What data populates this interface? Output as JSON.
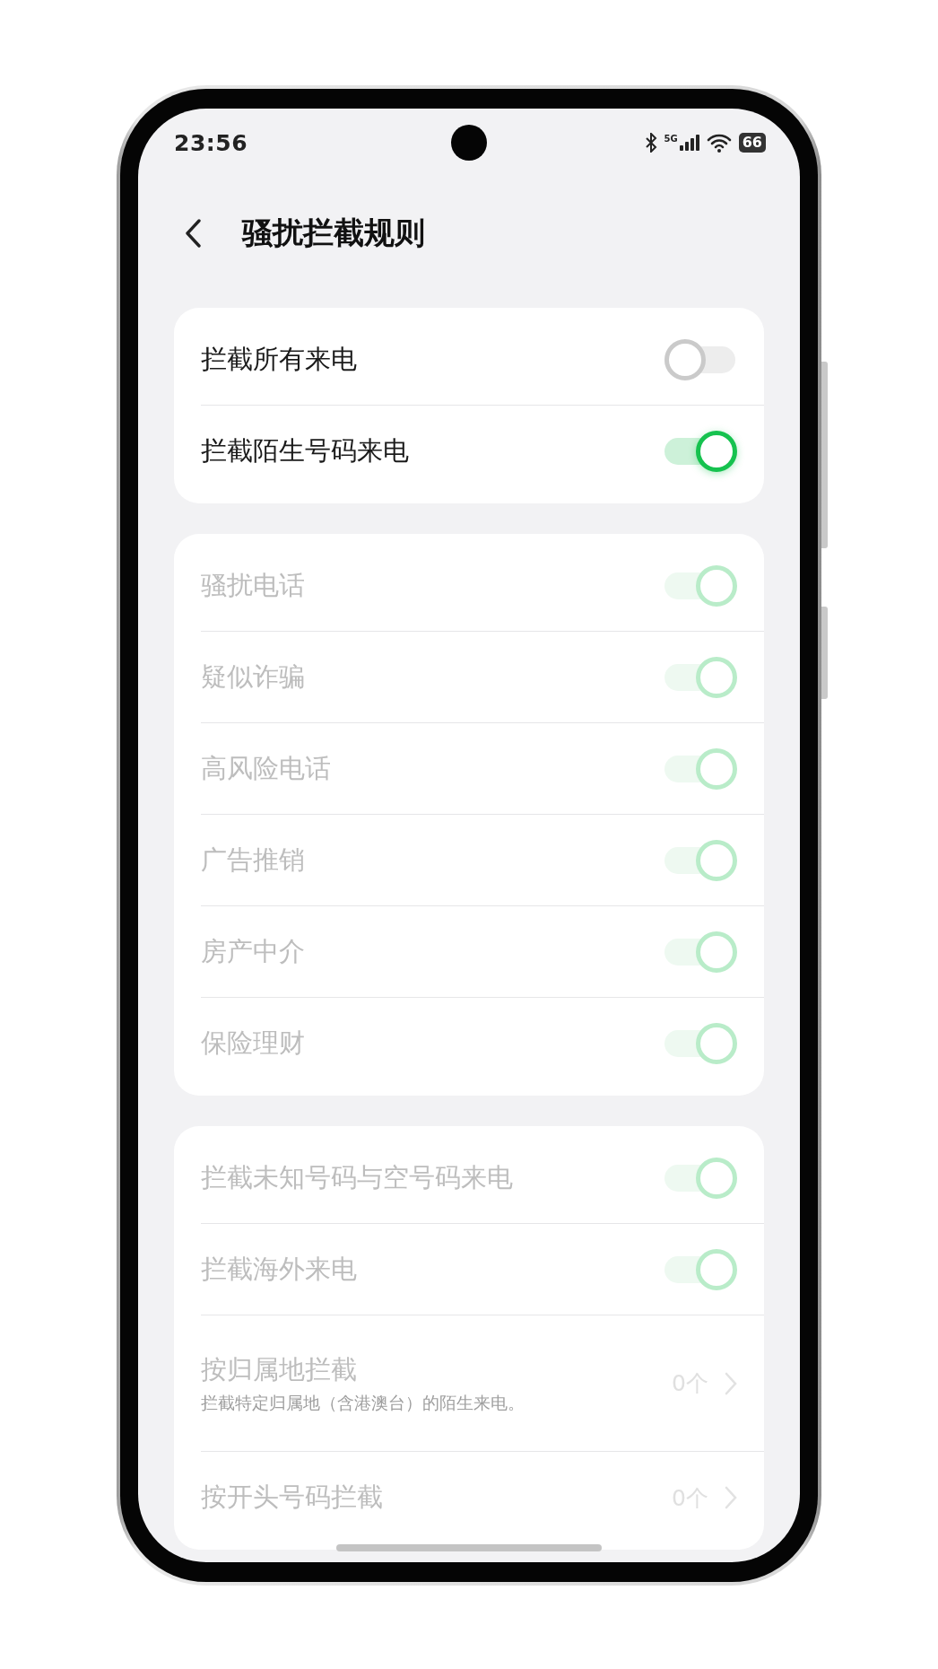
{
  "status_bar": {
    "time": "23:56",
    "network": "5G",
    "battery": "66"
  },
  "header": {
    "title": "骚扰拦截规则"
  },
  "cards": [
    {
      "rows": [
        {
          "kind": "toggle",
          "label": "拦截所有来电",
          "on": false,
          "disabled": false
        },
        {
          "kind": "toggle",
          "label": "拦截陌生号码来电",
          "on": true,
          "disabled": false
        }
      ]
    },
    {
      "rows": [
        {
          "kind": "toggle",
          "label": "骚扰电话",
          "on": true,
          "disabled": true
        },
        {
          "kind": "toggle",
          "label": "疑似诈骗",
          "on": true,
          "disabled": true
        },
        {
          "kind": "toggle",
          "label": "高风险电话",
          "on": true,
          "disabled": true
        },
        {
          "kind": "toggle",
          "label": "广告推销",
          "on": true,
          "disabled": true
        },
        {
          "kind": "toggle",
          "label": "房产中介",
          "on": true,
          "disabled": true
        },
        {
          "kind": "toggle",
          "label": "保险理财",
          "on": true,
          "disabled": true
        }
      ]
    },
    {
      "rows": [
        {
          "kind": "toggle",
          "label": "拦截未知号码与空号码来电",
          "on": true,
          "disabled": true
        },
        {
          "kind": "toggle",
          "label": "拦截海外来电",
          "on": true,
          "disabled": true
        },
        {
          "kind": "link",
          "label": "按归属地拦截",
          "subtitle": "拦截特定归属地（含港澳台）的陌生来电。",
          "count": "0个",
          "disabled": true
        },
        {
          "kind": "link",
          "label": "按开头号码拦截",
          "count": "0个",
          "disabled": true
        }
      ]
    }
  ]
}
